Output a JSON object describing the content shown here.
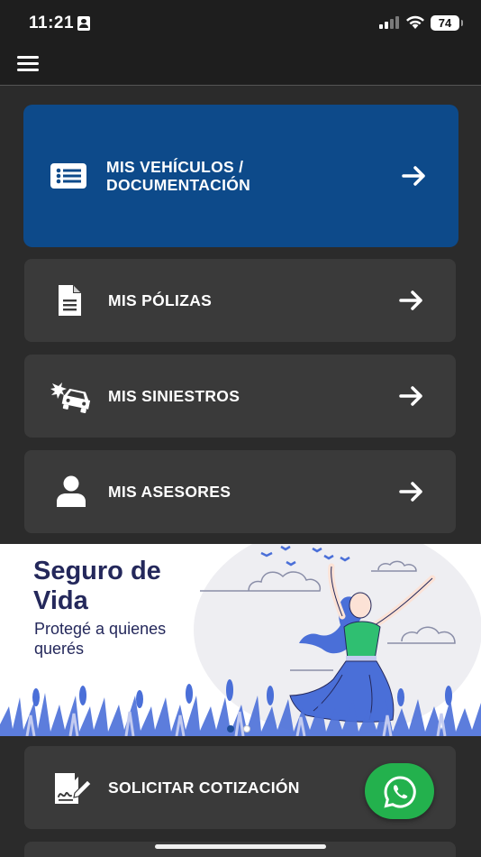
{
  "status_bar": {
    "time": "11:21",
    "battery": "74"
  },
  "header": {
    "menu_icon": "hamburger-menu-icon"
  },
  "menu": {
    "items": [
      {
        "label": "MIS VEHÍCULOS / DOCUMENTACIÓN",
        "icon": "id-card-list-icon"
      },
      {
        "label": "MIS PÓLIZAS",
        "icon": "document-icon"
      },
      {
        "label": "MIS SINIESTROS",
        "icon": "car-crash-icon"
      },
      {
        "label": "MIS ASESORES",
        "icon": "user-icon"
      },
      {
        "label": "SOLICITAR COTIZACIÓN",
        "icon": "signature-icon"
      }
    ],
    "arrow_icon": "arrow-right-icon"
  },
  "banner": {
    "title": "Seguro de Vida",
    "subtitle": "Protegé a quienes querés",
    "slide_count": 2,
    "active_slide": 1
  },
  "whatsapp": {
    "icon": "whatsapp-icon"
  },
  "colors": {
    "background": "#2b2b2b",
    "card": "#3a3a3a",
    "primary_card": "#0d4a8a",
    "banner_text": "#24285b",
    "whatsapp": "#23b14d",
    "illustration_blue": "#4a6fd8",
    "illustration_green": "#2fbf71"
  }
}
